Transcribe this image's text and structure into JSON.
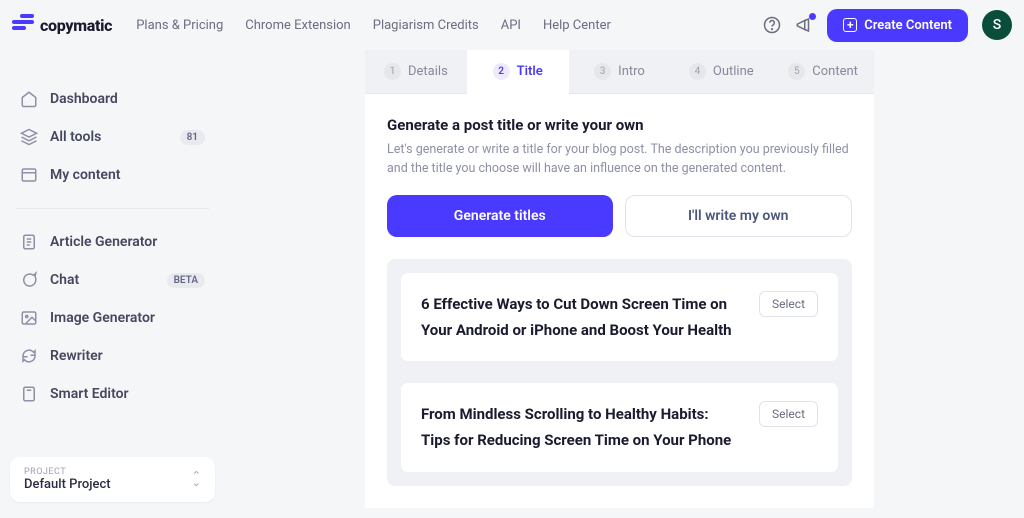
{
  "logo": {
    "text": "copymatic"
  },
  "topnav": {
    "plans": "Plans & Pricing",
    "chrome": "Chrome Extension",
    "plagiarism": "Plagiarism Credits",
    "api": "API",
    "help": "Help Center"
  },
  "header": {
    "create": "Create Content",
    "avatar": "S"
  },
  "sidebar": {
    "dashboard": "Dashboard",
    "alltools": "All tools",
    "alltools_badge": "81",
    "mycontent": "My content",
    "article": "Article Generator",
    "chat": "Chat",
    "chat_badge": "BETA",
    "image": "Image Generator",
    "rewriter": "Rewriter",
    "smarteditor": "Smart Editor"
  },
  "project": {
    "label": "PROJECT",
    "name": "Default Project"
  },
  "tabs": [
    {
      "num": "1",
      "label": "Details"
    },
    {
      "num": "2",
      "label": "Title"
    },
    {
      "num": "3",
      "label": "Intro"
    },
    {
      "num": "4",
      "label": "Outline"
    },
    {
      "num": "5",
      "label": "Content"
    }
  ],
  "panel": {
    "heading": "Generate a post title or write your own",
    "desc": "Let's generate or write a title for your blog post. The description you previously filled and the title you choose will have an influence on the generated content.",
    "btn_generate": "Generate titles",
    "btn_write": "I'll write my own",
    "select_label": "Select"
  },
  "titles": [
    "6 Effective Ways to Cut Down Screen Time on Your Android or iPhone and Boost Your Health",
    "From Mindless Scrolling to Healthy Habits: Tips for Reducing Screen Time on Your Phone"
  ]
}
